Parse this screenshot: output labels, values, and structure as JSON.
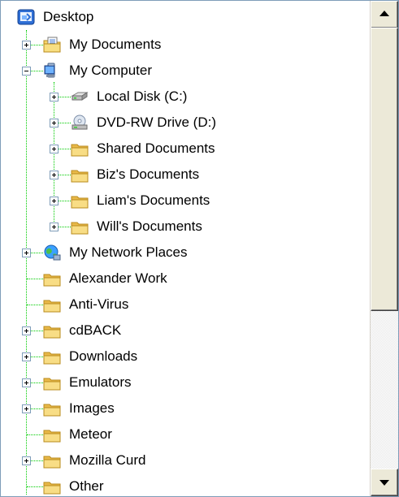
{
  "tree": {
    "root": {
      "label": "Desktop",
      "icon": "desktop-icon"
    },
    "items": [
      {
        "label": "My Documents",
        "icon": "my-documents-icon",
        "expander": "plus"
      },
      {
        "label": "My Computer",
        "icon": "my-computer-icon",
        "expander": "minus",
        "children": [
          {
            "label": "Local Disk (C:)",
            "icon": "hard-disk-icon",
            "expander": "plus"
          },
          {
            "label": "DVD-RW Drive (D:)",
            "icon": "dvd-drive-icon",
            "expander": "plus"
          },
          {
            "label": "Shared Documents",
            "icon": "folder-icon",
            "expander": "plus"
          },
          {
            "label": "Biz's Documents",
            "icon": "folder-icon",
            "expander": "plus"
          },
          {
            "label": "Liam's Documents",
            "icon": "folder-icon",
            "expander": "plus"
          },
          {
            "label": "Will's Documents",
            "icon": "folder-icon",
            "expander": "plus"
          }
        ]
      },
      {
        "label": "My Network Places",
        "icon": "network-places-icon",
        "expander": "plus"
      },
      {
        "label": "Alexander Work",
        "icon": "folder-icon",
        "expander": "none"
      },
      {
        "label": "Anti-Virus",
        "icon": "folder-icon",
        "expander": "none"
      },
      {
        "label": "cdBACK",
        "icon": "folder-icon",
        "expander": "plus"
      },
      {
        "label": "Downloads",
        "icon": "folder-icon",
        "expander": "plus"
      },
      {
        "label": "Emulators",
        "icon": "folder-icon",
        "expander": "plus"
      },
      {
        "label": "Images",
        "icon": "folder-icon",
        "expander": "plus"
      },
      {
        "label": "Meteor",
        "icon": "folder-icon",
        "expander": "none"
      },
      {
        "label": "Mozilla Curd",
        "icon": "folder-icon",
        "expander": "plus"
      },
      {
        "label": "Other",
        "icon": "folder-icon",
        "expander": "none"
      }
    ]
  },
  "colors": {
    "connector": "#00cc00",
    "border": "#7f9db9",
    "folder": "#f6d66b"
  }
}
